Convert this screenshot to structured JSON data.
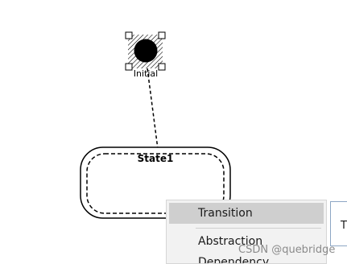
{
  "diagram": {
    "initial_label": "Initial",
    "state_label": "State1"
  },
  "context_menu": {
    "items": [
      {
        "label": "Transition",
        "highlighted": true
      },
      {
        "label": "Abstraction",
        "highlighted": false
      },
      {
        "label": "Dependency",
        "highlighted": false
      }
    ]
  },
  "side_panel": {
    "text": "T"
  },
  "watermark": {
    "text": "CSDN @quebridge"
  },
  "colors": {
    "menu_background": "#f2f2f2",
    "menu_highlight": "#cfcfcf",
    "panel_border": "#8da6c4",
    "diagram_stroke": "#000000"
  }
}
